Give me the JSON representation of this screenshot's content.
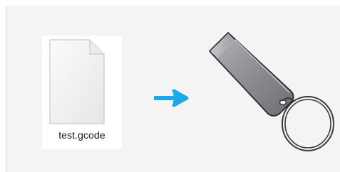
{
  "file": {
    "name": "test.gcode",
    "icon": "blank-document-icon"
  },
  "transfer": {
    "icon": "arrow-right-icon",
    "color": "#1aa8e6"
  },
  "target": {
    "icon": "usb-flash-drive-icon",
    "body_color": "#8a8b8f",
    "ring_color": "#3a3a3a"
  }
}
